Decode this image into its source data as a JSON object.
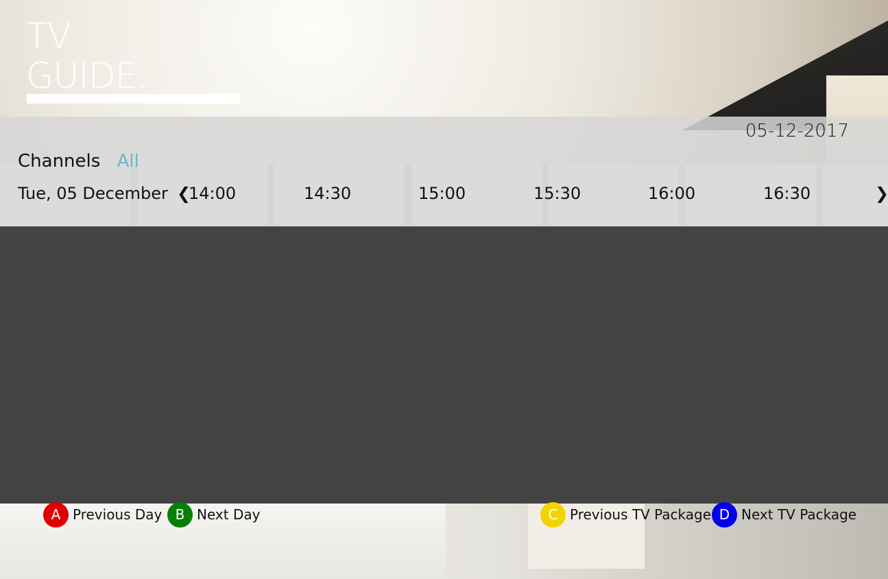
{
  "header": {
    "title_line1": "TV",
    "title_line2": "GUIDE."
  },
  "date": "05-12-2017",
  "channels": {
    "label": "Channels",
    "filter": "All"
  },
  "timeline": {
    "day": "Tue, 05 December",
    "slots": [
      "14:00",
      "14:30",
      "15:00",
      "15:30",
      "16:00",
      "16:30"
    ]
  },
  "icons": {
    "prev_arrow": "chevron-left-icon",
    "next_arrow": "chevron-right-icon"
  },
  "footer": {
    "buttons": [
      {
        "key": "A",
        "label": "Previous Day",
        "color": "#e00000"
      },
      {
        "key": "B",
        "label": "Next Day",
        "color": "#058005"
      },
      {
        "key": "C",
        "label": "Previous TV Package",
        "color": "#f2d400"
      },
      {
        "key": "D",
        "label": "Next TV Package",
        "color": "#0000ee"
      }
    ]
  },
  "colors": {
    "accent": "#6ab8c4",
    "grid_background": "#434343"
  }
}
